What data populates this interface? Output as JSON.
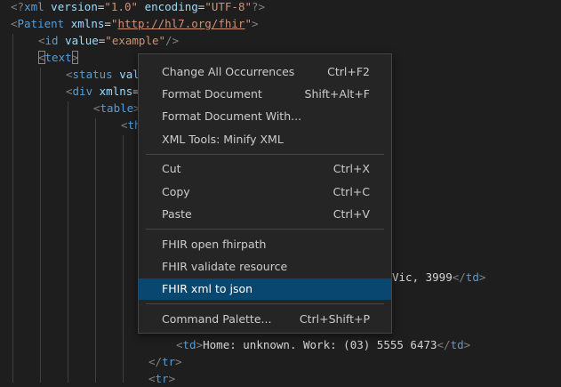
{
  "code": {
    "l1": {
      "p1": "<?",
      "decl": "xml",
      "a1": "version",
      "eq1": "=",
      "v1": "\"1.0\"",
      "a2": "encoding",
      "eq2": "=",
      "v2": "\"UTF-8\"",
      "p2": "?>"
    },
    "l2": {
      "p1": "<",
      "tag": "Patient",
      "a1": "xmlns",
      "eq1": "=",
      "q1": "\"",
      "url": "http://hl7.org/fhir",
      "q2": "\"",
      "p2": ">"
    },
    "l3": {
      "p1": "<",
      "tag": "id",
      "a1": "value",
      "eq1": "=",
      "v1": "\"example\"",
      "p2": "/>"
    },
    "l4": {
      "p1": "<",
      "tag": "text",
      "p2": ">"
    },
    "l5": {
      "p1": "<",
      "tag": "status",
      "a1": "val"
    },
    "l6": {
      "p1": "<",
      "tag": "div",
      "a1": "xmlns",
      "eq1": "="
    },
    "l7": {
      "p1": "<",
      "tag": "table",
      "p2": ">"
    },
    "l8": {
      "p1": "<",
      "tag": "th"
    },
    "l9": {
      "txt": "Vic, 3999",
      "p1": "</",
      "tag": "td",
      "p2": ">"
    },
    "l10": {
      "p1": "<",
      "tag": "td",
      "p2": ">",
      "txt": "Home: unknown. Work: (03) 5555 6473",
      "p3": "</",
      "tag2": "td",
      "p4": ">"
    },
    "l11": {
      "p1": "</",
      "tag": "tr",
      "p2": ">"
    },
    "l12": {
      "p1": "<",
      "tag": "tr",
      "p2": ">"
    }
  },
  "context_menu": {
    "items": [
      {
        "label": "Change All Occurrences",
        "shortcut": "Ctrl+F2"
      },
      {
        "label": "Format Document",
        "shortcut": "Shift+Alt+F"
      },
      {
        "label": "Format Document With...",
        "shortcut": ""
      },
      {
        "label": "XML Tools: Minify XML",
        "shortcut": ""
      },
      {
        "label": "Cut",
        "shortcut": "Ctrl+X"
      },
      {
        "label": "Copy",
        "shortcut": "Ctrl+C"
      },
      {
        "label": "Paste",
        "shortcut": "Ctrl+V"
      },
      {
        "label": "FHIR open fhirpath",
        "shortcut": ""
      },
      {
        "label": "FHIR validate resource",
        "shortcut": ""
      },
      {
        "label": "FHIR xml to json",
        "shortcut": "",
        "highlighted": true
      },
      {
        "label": "Command Palette...",
        "shortcut": "Ctrl+Shift+P"
      }
    ]
  },
  "colors": {
    "editor_background": "#1e1e1e",
    "menu_background": "#252526",
    "menu_highlight": "#094771",
    "tag": "#569cd6",
    "attribute": "#9cdcfe",
    "string": "#ce9178"
  }
}
